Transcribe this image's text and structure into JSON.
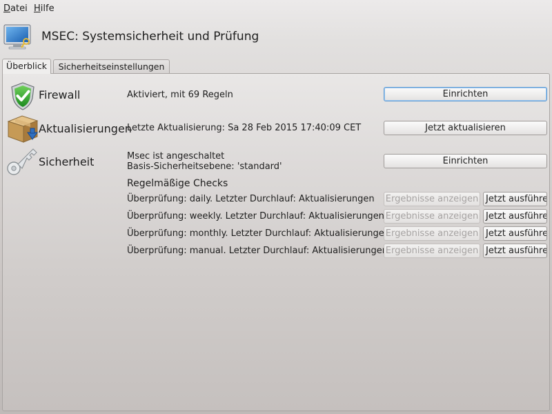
{
  "menu": {
    "file": {
      "mnemonic": "D",
      "rest": "atei"
    },
    "help": {
      "mnemonic": "H",
      "rest": "ilfe"
    }
  },
  "header": {
    "title": "MSEC: Systemsicherheit und Prüfung",
    "icon": "monitor-key-icon"
  },
  "tabs": [
    {
      "label": "Überblick",
      "active": true
    },
    {
      "label": "Sicherheitseinstellungen",
      "active": false
    }
  ],
  "sections": {
    "firewall": {
      "icon": "shield-check-icon",
      "name": "Firewall",
      "status": "Aktiviert, mit 69 Regeln",
      "button": "Einrichten"
    },
    "updates": {
      "icon": "package-download-icon",
      "name": "Aktualisierungen",
      "status": "Letzte Aktualisierung: Sa 28 Feb 2015 17:40:09 CET",
      "button": "Jetzt aktualisieren"
    },
    "security": {
      "icon": "key-icon",
      "name": "Sicherheit",
      "status_line1": "Msec ist angeschaltet",
      "status_line2": "Basis-Sicherheitsebene: 'standard'",
      "button": "Einrichten"
    }
  },
  "checks": {
    "title": "Regelmäßige Checks",
    "items": [
      {
        "text": "Überprüfung: daily. Letzter Durchlauf: Aktualisierungen",
        "results_label": "Ergebnisse anzeigen",
        "run_label": "Jetzt ausführen"
      },
      {
        "text": "Überprüfung: weekly. Letzter Durchlauf: Aktualisierungen",
        "results_label": "Ergebnisse anzeigen",
        "run_label": "Jetzt ausführen"
      },
      {
        "text": "Überprüfung: monthly. Letzter Durchlauf: Aktualisierungen",
        "results_label": "Ergebnisse anzeigen",
        "run_label": "Jetzt ausführen"
      },
      {
        "text": "Überprüfung: manual. Letzter Durchlauf: Aktualisierungen",
        "results_label": "Ergebnisse anzeigen",
        "run_label": "Jetzt ausführen"
      }
    ]
  },
  "colors": {
    "focus_border": "#5d9bd6",
    "shield_green": "#2fa52f",
    "disabled_text": "#a6a3a2"
  }
}
